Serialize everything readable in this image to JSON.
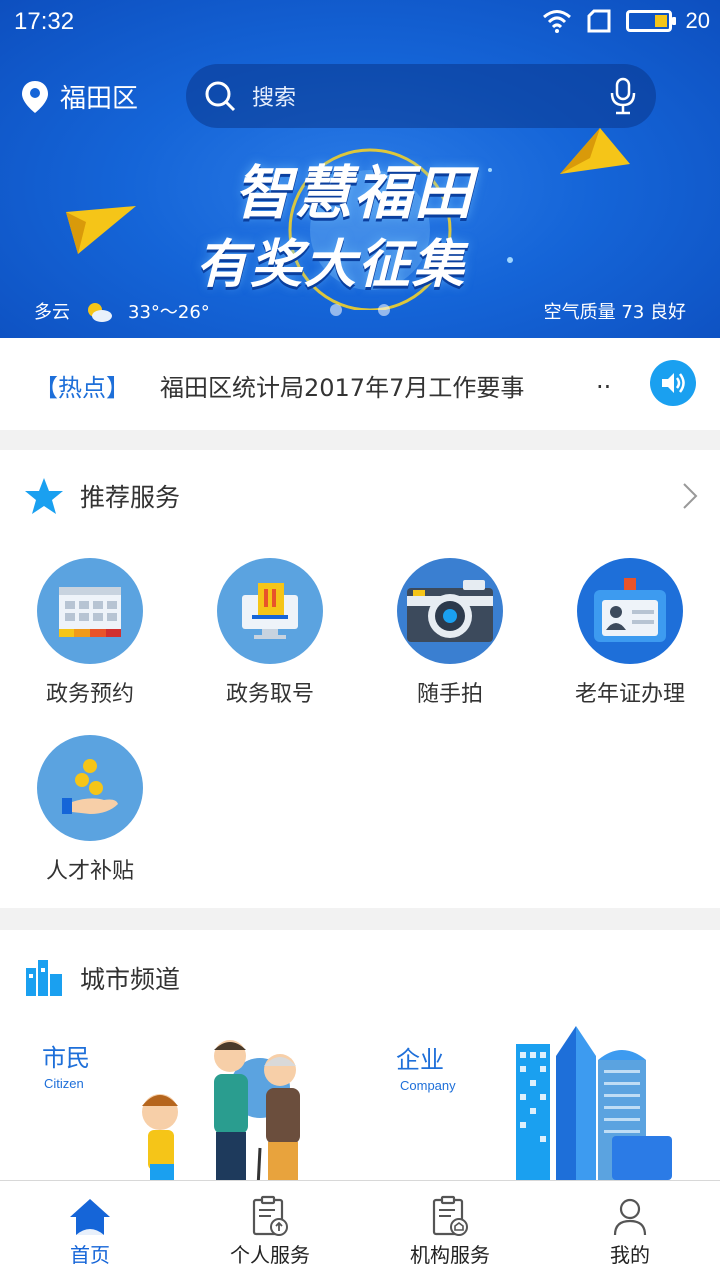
{
  "status_bar": {
    "time": "17:32",
    "battery": "20"
  },
  "header": {
    "location": "福田区",
    "search_placeholder": "搜索"
  },
  "banner": {
    "headline_line1": "智慧福田",
    "headline_line2": "有奖大征集",
    "weather_condition": "多云",
    "temperature": "33°～26°",
    "air_quality": "空气质量 73 良好"
  },
  "hot": {
    "tag": "【热点】",
    "text": "福田区统计局2017年7月工作要事",
    "more": ".."
  },
  "recommended": {
    "title": "推荐服务",
    "items": [
      {
        "label": "政务预约",
        "icon": "calendar-icon"
      },
      {
        "label": "政务取号",
        "icon": "ticket-machine-icon"
      },
      {
        "label": "随手拍",
        "icon": "camera-icon"
      },
      {
        "label": "老年证办理",
        "icon": "id-card-icon"
      },
      {
        "label": "人才补贴",
        "icon": "coins-hand-icon"
      }
    ]
  },
  "city": {
    "title": "城市频道",
    "citizen_cn": "市民",
    "citizen_en": "Citizen",
    "company_cn": "企业",
    "company_en": "Company"
  },
  "tabs": [
    {
      "label": "首页",
      "icon": "home-icon",
      "active": true
    },
    {
      "label": "个人服务",
      "icon": "clipboard-person-icon",
      "active": false
    },
    {
      "label": "机构服务",
      "icon": "clipboard-building-icon",
      "active": false
    },
    {
      "label": "我的",
      "icon": "person-icon",
      "active": false
    }
  ],
  "colors": {
    "brand_blue": "#1565d8",
    "accent_blue": "#1e6fd9",
    "speaker_blue": "#1aa0f0",
    "icon_circle": "#5ba3e0"
  }
}
